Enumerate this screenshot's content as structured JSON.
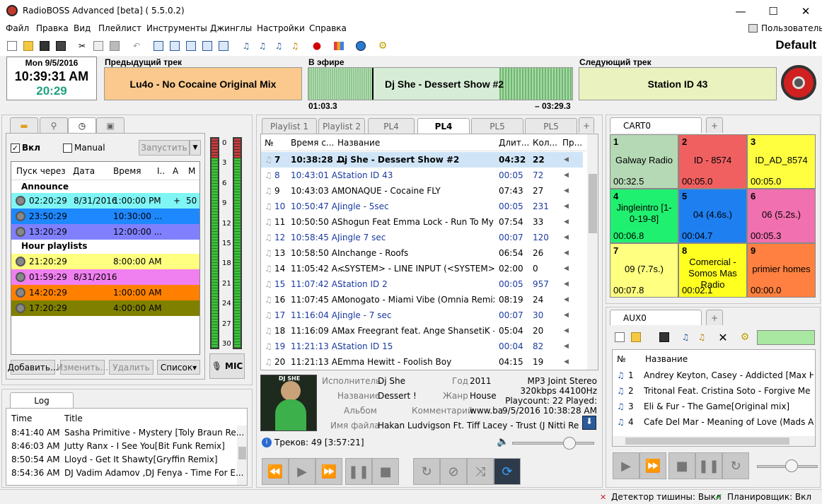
{
  "window": {
    "title": "RadioBOSS Advanced [beta] ( 5.5.0.2)",
    "minimize": "—",
    "maximize": "☐",
    "close": "✕"
  },
  "menu": [
    "Файл",
    "Правка",
    "Вид",
    "Плейлист",
    "Инструменты",
    "Джинглы",
    "Настройки",
    "Справка"
  ],
  "user_label": "Пользователь",
  "profile": "Default",
  "clock": {
    "date": "Mon 9/5/2016",
    "time": "10:39:31 AM",
    "countdown": "20:29"
  },
  "prev_track": {
    "label": "Предыдущий трек",
    "title": "Lu4o - No Cocaine  Original Mix"
  },
  "on_air": {
    "label": "В эфире",
    "title": "Dj She - Dessert Show #2",
    "elapsed": "01:03.3",
    "remaining": "– 03:29.3"
  },
  "next_track": {
    "label": "Следующий трек",
    "title": "Station ID 43"
  },
  "scheduler": {
    "enabled_label": "Вкл",
    "manual_label": "Manual",
    "run_button": "Запустить",
    "columns": [
      "Пуск через",
      "Дата",
      "Время",
      "I..",
      "A",
      "M"
    ],
    "group1": "Announce",
    "group2": "Hour playlists",
    "rows": [
      {
        "start": "02:20:29",
        "date": "8/31/2016",
        "time": "1:00:00 PM",
        "a": "+",
        "m": "50",
        "color": "#7ff5f5"
      },
      {
        "start": "23:50:29",
        "date": "",
        "time": "10:30:00 ...",
        "a": "",
        "m": "",
        "color": "#1e88ff"
      },
      {
        "start": "13:20:29",
        "date": "",
        "time": "12:00:00 ...",
        "a": "",
        "m": "",
        "color": "#8080ff"
      },
      {
        "start": "21:20:29",
        "date": "",
        "time": "8:00:00 AM",
        "a": "",
        "m": "",
        "color": "#ffff80"
      },
      {
        "start": "01:59:29",
        "date": "8/31/2016",
        "time": "",
        "a": "",
        "m": "",
        "color": "#f07ff0"
      },
      {
        "start": "14:20:29",
        "date": "",
        "time": "1:00:00 AM",
        "a": "",
        "m": "",
        "color": "#ff8000"
      },
      {
        "start": "17:20:29",
        "date": "",
        "time": "4:00:00 AM",
        "a": "",
        "m": "",
        "color": "#808000"
      }
    ],
    "buttons": [
      "Добавить...",
      "Изменить...",
      "Удалить",
      "Список▾"
    ]
  },
  "meter": {
    "ticks": [
      "0",
      "3",
      "6",
      "9",
      "12",
      "15",
      "18",
      "21",
      "24",
      "27",
      "30"
    ],
    "mic_label": "MIC"
  },
  "log": {
    "tab": "Log",
    "columns": [
      "Time",
      "Title"
    ],
    "rows": [
      {
        "time": "8:41:40 AM",
        "title": "Sasha Primitive - Mystery [Toly Braun Re..."
      },
      {
        "time": "8:46:03 AM",
        "title": "Jutty Ranx - I See You[Bit Funk Remix]"
      },
      {
        "time": "8:50:54 AM",
        "title": "Lloyd - Get It Shawty[Gryffin Remix]"
      },
      {
        "time": "8:54:36 AM",
        "title": "DJ Vadim Adamov ,DJ Fenya - Time For E..."
      }
    ]
  },
  "playlist": {
    "tabs": [
      "Playlist 1",
      "Playlist 2",
      "PL4",
      "PL4",
      "PL5",
      "PL5"
    ],
    "columns": [
      "№",
      "Время с...",
      "Название",
      "Длит...",
      "Кол...",
      "Пр..."
    ],
    "rows": [
      {
        "n": "7",
        "time": "10:38:28 ...",
        "title": "Dj She - Dessert Show #2",
        "dur": "04:32",
        "count": "22",
        "type": "current"
      },
      {
        "n": "8",
        "time": "10:43:01 A...",
        "title": "Station ID 43",
        "dur": "00:05",
        "count": "72",
        "type": "jingle"
      },
      {
        "n": "9",
        "time": "10:43:03 A...",
        "title": "MONAQUE - Cocaine FLY",
        "dur": "07:43",
        "count": "27",
        "type": "track"
      },
      {
        "n": "10",
        "time": "10:50:47 A...",
        "title": "Jingle - 5sec",
        "dur": "00:05",
        "count": "231",
        "type": "jingle"
      },
      {
        "n": "11",
        "time": "10:50:50 A...",
        "title": "Shogun Feat Emma Lock - Run To My Re...",
        "dur": "07:54",
        "count": "33",
        "type": "track"
      },
      {
        "n": "12",
        "time": "10:58:45 A...",
        "title": "Jingle 7 sec",
        "dur": "00:07",
        "count": "120",
        "type": "jingle"
      },
      {
        "n": "13",
        "time": "10:58:50 A...",
        "title": "Inchange - Roofs",
        "dur": "06:54",
        "count": "26",
        "type": "track"
      },
      {
        "n": "14",
        "time": "11:05:42 A...",
        "title": "<SYSTEM> - LINE INPUT (<SYSTEM> - L...",
        "dur": "02:00",
        "count": "0",
        "type": "track"
      },
      {
        "n": "15",
        "time": "11:07:42 A...",
        "title": "Station ID 2",
        "dur": "00:05",
        "count": "957",
        "type": "jingle"
      },
      {
        "n": "16",
        "time": "11:07:45 A...",
        "title": "Monogato - Miami Vibe (Omnia Remix)",
        "dur": "08:19",
        "count": "24",
        "type": "track"
      },
      {
        "n": "17",
        "time": "11:16:04 A...",
        "title": "Jingle - 7 sec",
        "dur": "00:07",
        "count": "30",
        "type": "jingle"
      },
      {
        "n": "18",
        "time": "11:16:09 A...",
        "title": "Max Freegrant feat. Ange ShansetiK - Ab...",
        "dur": "05:04",
        "count": "20",
        "type": "track"
      },
      {
        "n": "19",
        "time": "11:21:13 A...",
        "title": "Station ID 15",
        "dur": "00:04",
        "count": "82",
        "type": "jingle"
      },
      {
        "n": "20",
        "time": "11:21:13 A...",
        "title": "Emma Hewitt - Foolish Boy",
        "dur": "04:15",
        "count": "19",
        "type": "track"
      }
    ],
    "info": {
      "artist_lbl": "Исполнитель",
      "artist": "Dj She",
      "year_lbl": "Год",
      "year": "2011",
      "title_lbl": "Название",
      "title": "Dessert !",
      "genre_lbl": "Жанр",
      "genre": "House",
      "album_lbl": "Альбом",
      "album": "",
      "comment_lbl": "Комментарий",
      "comment": "www.ba",
      "file_lbl": "Имя файла",
      "file": "Hakan Ludvigson Ft. Tiff Lacey - Trust (J Nitti Remix",
      "format": "MP3 Joint Stereo",
      "bitrate": "320kbps 44100Hz",
      "playcount": "Playcount: 22  Played:",
      "played": "9/5/2016 10:38:28 AM",
      "cover_text": "DJ SHE"
    },
    "status": "Треков: 49 [3:57:21]"
  },
  "cart": {
    "tab": "CART0",
    "cells": [
      {
        "n": "1",
        "name": "Galway Radio",
        "time": "00:32.5",
        "color": "#b5d9b5"
      },
      {
        "n": "2",
        "name": "ID - 8574",
        "time": "00:05.0",
        "color": "#f06060"
      },
      {
        "n": "3",
        "name": "ID_AD_8574",
        "time": "00:05.0",
        "color": "#ffff40"
      },
      {
        "n": "4",
        "name": "Jingleintro [1-0-19-8]",
        "time": "00:06.8",
        "color": "#20f070"
      },
      {
        "n": "5",
        "name": "04 (4.6s.)",
        "time": "00:04.7",
        "color": "#1e7ff0"
      },
      {
        "n": "6",
        "name": "06 (5.2s.)",
        "time": "00:05.3",
        "color": "#f070b0"
      },
      {
        "n": "7",
        "name": "09 (7.7s.)",
        "time": "00:07.8",
        "color": "#ffff80"
      },
      {
        "n": "8",
        "name": "Comercial - Somos Mas Radio",
        "time": "00:02.1",
        "color": "#ffff20"
      },
      {
        "n": "9",
        "name": "primier homes",
        "time": "00:00.0",
        "color": "#ff8040"
      }
    ]
  },
  "aux": {
    "tab": "AUX0",
    "columns": [
      "№",
      "Название"
    ],
    "rows": [
      {
        "n": "1",
        "title": "Andrey Keyton, Casey - Addicted [Max Hydr..."
      },
      {
        "n": "2",
        "title": "Tritonal Feat. Cristina Soto - Forgive Me For..."
      },
      {
        "n": "3",
        "title": "Eli & Fur - The Game[Original mix]"
      },
      {
        "n": "4",
        "title": "Cafe Del Mar - Meaning of Love (Mads Arp)"
      }
    ]
  },
  "statusbar": {
    "silence": "Детектор тишины: Выкл",
    "scheduler": "Планировщик: Вкл"
  }
}
